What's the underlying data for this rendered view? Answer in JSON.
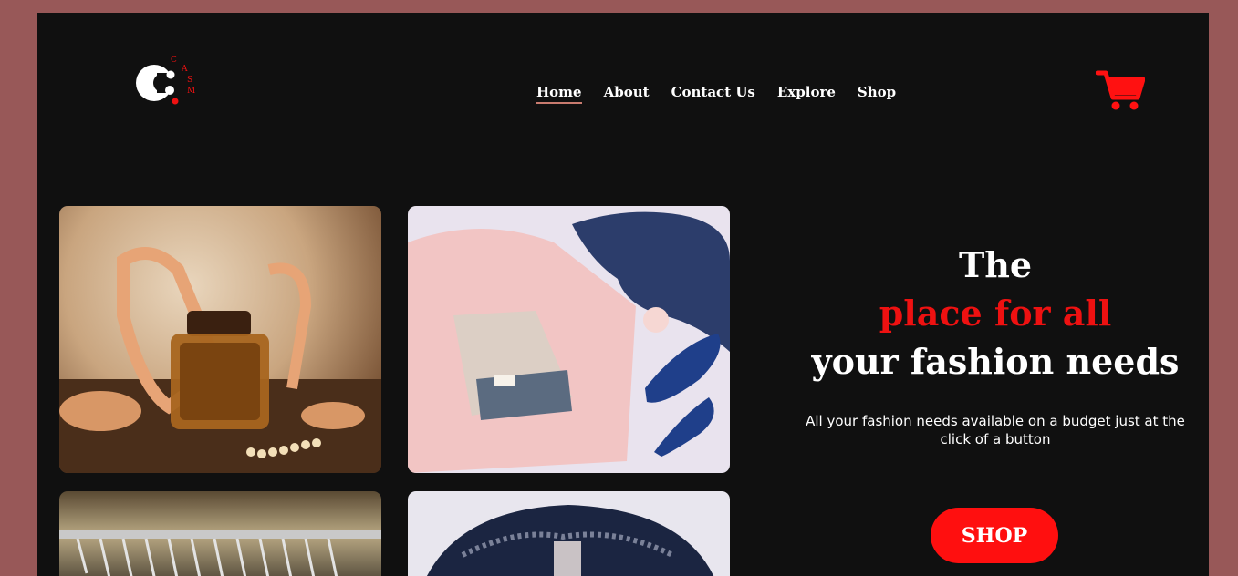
{
  "brand": {
    "logo_letter": "c",
    "logo_text": "CASM",
    "accent_color": "#ee1111",
    "background_color": "#101010",
    "outer_color": "#985858"
  },
  "nav": {
    "items": [
      {
        "label": "Home",
        "active": true
      },
      {
        "label": "About",
        "active": false
      },
      {
        "label": "Contact Us",
        "active": false
      },
      {
        "label": "Explore",
        "active": false
      },
      {
        "label": "Shop",
        "active": false
      }
    ],
    "cart_icon": "shopping-cart-icon"
  },
  "hero": {
    "line1": "The",
    "line2": "place for all",
    "line3": "your fashion needs",
    "subtitle": "All your fashion needs available on a budget just at the click of a button",
    "cta_label": "SHOP"
  },
  "gallery": [
    {
      "name": "sandals-perfume-photo"
    },
    {
      "name": "bag-heels-scarf-photo"
    },
    {
      "name": "clothing-rack-photo"
    },
    {
      "name": "cap-photo"
    }
  ]
}
